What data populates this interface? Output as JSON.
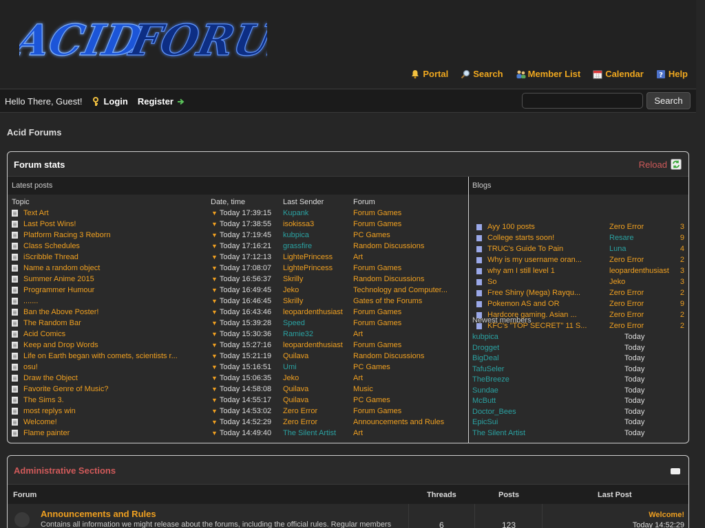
{
  "header": {
    "logo_text": "Acid Forums",
    "menu": [
      {
        "label": "Portal",
        "icon": "bell-icon"
      },
      {
        "label": "Search",
        "icon": "magnifier-icon"
      },
      {
        "label": "Member List",
        "icon": "members-icon"
      },
      {
        "label": "Calendar",
        "icon": "calendar-icon"
      },
      {
        "label": "Help",
        "icon": "help-icon"
      }
    ]
  },
  "panel": {
    "greeting": "Hello There, Guest!",
    "login": "Login",
    "register": "Register",
    "search_value": "",
    "search_button": "Search"
  },
  "breadcrumb": "Acid Forums",
  "stats": {
    "title": "Forum stats",
    "reload": "Reload",
    "latest_label": "Latest posts",
    "columns": {
      "topic": "Topic",
      "date": "Date, time",
      "sender": "Last Sender",
      "forum": "Forum"
    },
    "rows": [
      {
        "topic": "Text Art",
        "date": "Today 17:39:15",
        "sender": "Kupank",
        "sender_color": "#2aa2a2",
        "forum": "Forum Games"
      },
      {
        "topic": "Last Post Wins!",
        "date": "Today 17:38:55",
        "sender": "isokissa3",
        "sender_color": "#f0a020",
        "forum": "Forum Games"
      },
      {
        "topic": "Platform Racing 3 Reborn",
        "date": "Today 17:19:45",
        "sender": "kubpica",
        "sender_color": "#2aa2a2",
        "forum": "PC Games"
      },
      {
        "topic": "Class Schedules",
        "date": "Today 17:16:21",
        "sender": "grassfire",
        "sender_color": "#2aa2a2",
        "forum": "Random Discussions"
      },
      {
        "topic": "iScribble Thread",
        "date": "Today 17:12:13",
        "sender": "LightePrincess",
        "sender_color": "#f0a020",
        "forum": "Art"
      },
      {
        "topic": "Name a random object",
        "date": "Today 17:08:07",
        "sender": "LightePrincess",
        "sender_color": "#f0a020",
        "forum": "Forum Games"
      },
      {
        "topic": "Summer Anime 2015",
        "date": "Today 16:56:37",
        "sender": "Skrilly",
        "sender_color": "#f0a020",
        "forum": "Random Discussions"
      },
      {
        "topic": "Programmer Humour",
        "date": "Today 16:49:45",
        "sender": "Jeko",
        "sender_color": "#f0a020",
        "forum": "Technology and Computer..."
      },
      {
        "topic": ".......",
        "date": "Today 16:46:45",
        "sender": "Skrilly",
        "sender_color": "#f0a020",
        "forum": "Gates of the Forums"
      },
      {
        "topic": "Ban the Above Poster!",
        "date": "Today 16:43:46",
        "sender": "leopardenthusiast",
        "sender_color": "#f0a020",
        "forum": "Forum Games"
      },
      {
        "topic": "The Random Bar",
        "date": "Today 15:39:28",
        "sender": "Speed",
        "sender_color": "#2aa2a2",
        "forum": "Forum Games"
      },
      {
        "topic": "Acid Comics",
        "date": "Today 15:30:36",
        "sender": "Ramie32",
        "sender_color": "#2aa2a2",
        "forum": "Art"
      },
      {
        "topic": "Keep and Drop Words",
        "date": "Today 15:27:16",
        "sender": "leopardenthusiast",
        "sender_color": "#f0a020",
        "forum": "Forum Games"
      },
      {
        "topic": "Life on Earth began with comets, scientists r...",
        "date": "Today 15:21:19",
        "sender": "Quilava",
        "sender_color": "#f0a020",
        "forum": "Random Discussions"
      },
      {
        "topic": "osu!",
        "date": "Today 15:16:51",
        "sender": "Umi",
        "sender_color": "#2aa2a2",
        "forum": "PC Games"
      },
      {
        "topic": "Draw the Object",
        "date": "Today 15:06:35",
        "sender": "Jeko",
        "sender_color": "#f0a020",
        "forum": "Art"
      },
      {
        "topic": "Favorite Genre of Music?",
        "date": "Today 14:58:08",
        "sender": "Quilava",
        "sender_color": "#f0a020",
        "forum": "Music"
      },
      {
        "topic": "The Sims 3.",
        "date": "Today 14:55:17",
        "sender": "Quilava",
        "sender_color": "#f0a020",
        "forum": "PC Games"
      },
      {
        "topic": "most replys win",
        "date": "Today 14:53:02",
        "sender": "Zero Error",
        "sender_color": "#f0a020",
        "forum": "Forum Games"
      },
      {
        "topic": "Welcome!",
        "date": "Today 14:52:29",
        "sender": "Zero Error",
        "sender_color": "#f0a020",
        "forum": "Announcements and Rules"
      },
      {
        "topic": "Flame painter",
        "date": "Today 14:49:40",
        "sender": "The Silent Artist",
        "sender_color": "#2aa2a2",
        "forum": "Art"
      }
    ],
    "blogs_label": "Blogs",
    "blogs": [
      {
        "title": "Ayy 100 posts",
        "author": "Zero Error",
        "author_color": "#f0a020",
        "count": "3"
      },
      {
        "title": "College starts soon!",
        "author": "Resare",
        "author_color": "#2aa2a2",
        "count": "9"
      },
      {
        "title": "TRUC's Guide To Pain",
        "author": "Luna",
        "author_color": "#2aa2a2",
        "count": "4"
      },
      {
        "title": "Why is my username oran...",
        "author": "Zero Error",
        "author_color": "#f0a020",
        "count": "2"
      },
      {
        "title": "why am I still level 1",
        "author": "leopardenthusiast",
        "author_color": "#f0a020",
        "count": "3"
      },
      {
        "title": "So",
        "author": "Jeko",
        "author_color": "#f0a020",
        "count": "3"
      },
      {
        "title": "Free Shiny (Mega) Rayqu...",
        "author": "Zero Error",
        "author_color": "#f0a020",
        "count": "2"
      },
      {
        "title": "Pokemon AS and OR",
        "author": "Zero Error",
        "author_color": "#f0a020",
        "count": "9"
      },
      {
        "title": "Hardcore gaming. Asian ...",
        "author": "Zero Error",
        "author_color": "#f0a020",
        "count": "2"
      },
      {
        "title": "KFC's \"TOP SECRET\" 11 S...",
        "author": "Zero Error",
        "author_color": "#f0a020",
        "count": "2"
      }
    ],
    "newest_label": "Newest members",
    "members": [
      {
        "name": "kubpica",
        "date": "Today"
      },
      {
        "name": "Drogget",
        "date": "Today"
      },
      {
        "name": "BigDeal",
        "date": "Today"
      },
      {
        "name": "TafuSeler",
        "date": "Today"
      },
      {
        "name": "TheBreeze",
        "date": "Today"
      },
      {
        "name": "Sundae",
        "date": "Today"
      },
      {
        "name": "McButt",
        "date": "Today"
      },
      {
        "name": "Doctor_Bees",
        "date": "Today"
      },
      {
        "name": "EpicSui",
        "date": "Today"
      },
      {
        "name": "The Silent Artist",
        "date": "Today"
      }
    ]
  },
  "admin": {
    "title": "Administrative Sections",
    "columns": {
      "forum": "Forum",
      "threads": "Threads",
      "posts": "Posts",
      "last_post": "Last Post"
    },
    "forum": {
      "name": "Announcements and Rules",
      "description": "Contains all information we might release about the forums, including the official rules. Regular members",
      "threads": "6",
      "posts": "123",
      "last_post_title": "Welcome!",
      "last_post_time": "Today 14:52:29"
    }
  }
}
